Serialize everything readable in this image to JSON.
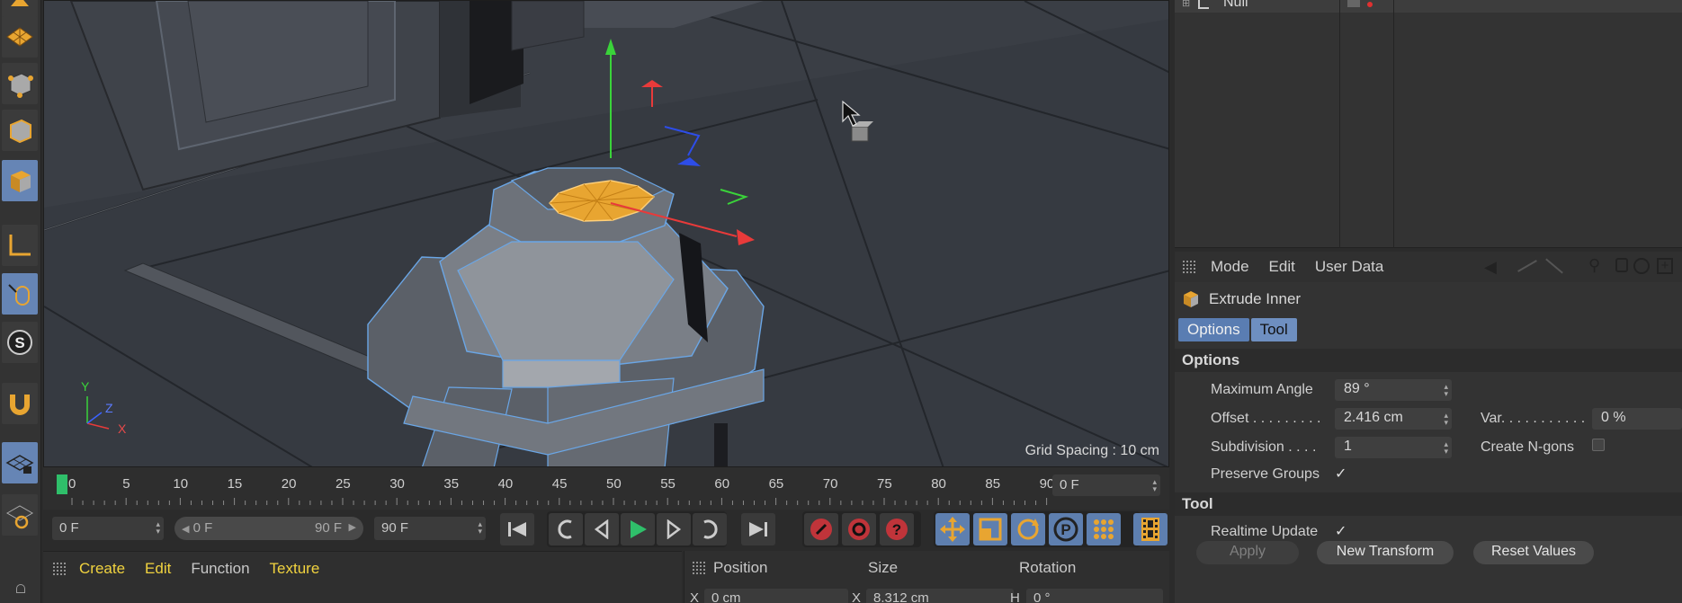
{
  "viewport": {
    "grid_label": "Grid Spacing : 10 cm",
    "axis_labels": {
      "y": "Y",
      "z": "Z",
      "x": "X"
    }
  },
  "timeline": {
    "ticks": [
      "0",
      "5",
      "10",
      "15",
      "20",
      "25",
      "30",
      "35",
      "40",
      "45",
      "50",
      "55",
      "60",
      "65",
      "70",
      "75",
      "80",
      "85",
      "90"
    ],
    "current_frame": "0 F"
  },
  "transport": {
    "start_frame": "0 F",
    "range_start": "0 F",
    "range_end": "90 F",
    "end_frame": "90 F"
  },
  "material_manager": {
    "menu": [
      "Create",
      "Edit",
      "Function",
      "Texture"
    ]
  },
  "coordinates": {
    "headers": {
      "position": "Position",
      "size": "Size",
      "rotation": "Rotation"
    },
    "row": {
      "pos_label": "X",
      "pos_value": "0 cm",
      "size_label": "X",
      "size_value": "8.312 cm",
      "rot_label": "H",
      "rot_value": "0 °"
    }
  },
  "object_manager": {
    "object_name": "Null"
  },
  "attribute_manager": {
    "menu": {
      "mode": "Mode",
      "edit": "Edit",
      "user_data": "User Data"
    },
    "title": "Extrude Inner",
    "tabs": {
      "options": "Options",
      "tool": "Tool"
    },
    "section_options": "Options",
    "max_angle_label": "Maximum Angle",
    "max_angle_value": "89 °",
    "offset_label": "Offset . . . . . . . . .",
    "offset_value": "2.416 cm",
    "var_label": "Var. . . . . . . . . . .",
    "var_value": "0 %",
    "subdivision_label": "Subdivision . . . .",
    "subdivision_value": "1",
    "create_ngons_label": "Create N-gons",
    "preserve_groups_label": "Preserve Groups",
    "section_tool": "Tool",
    "realtime_update_label": "Realtime Update",
    "buttons": {
      "apply": "Apply",
      "new_transform": "New Transform",
      "reset_values": "Reset Values"
    },
    "check_mark": "✓"
  },
  "colors": {
    "accent_blue": "#6685b5",
    "selection_orange": "#e8a531",
    "playhead_green": "#2fbf6a",
    "menu_yellow": "#f1d33f"
  }
}
